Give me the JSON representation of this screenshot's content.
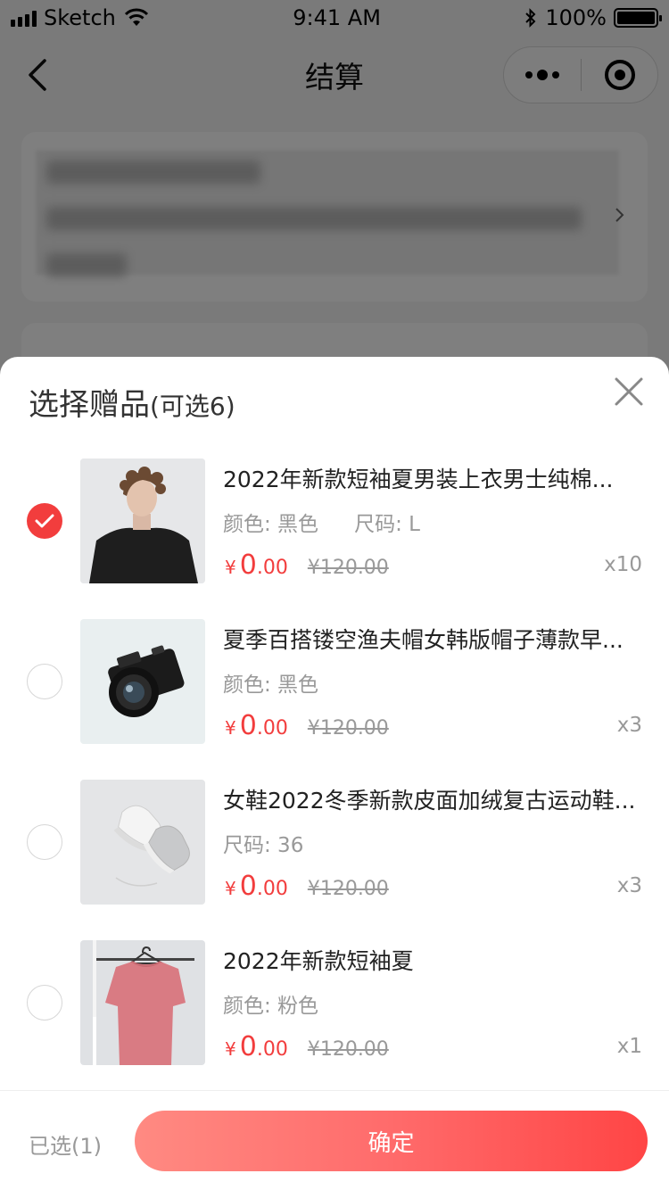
{
  "status_bar": {
    "carrier": "Sketch",
    "time": "9:41 AM",
    "battery": "100%"
  },
  "nav": {
    "title": "结算"
  },
  "popup": {
    "title": "选择赠品",
    "subtitle": "(可选6)",
    "currency_symbol": "¥",
    "items": [
      {
        "name": "2022年新款短袖夏男装上衣男士纯棉...",
        "spec_1": "颜色: 黑色",
        "spec_2": "尺码: L",
        "price_int": "0",
        "price_dec": ".00",
        "original_price": "¥120.00",
        "quantity": "x10",
        "checked": true
      },
      {
        "name": "夏季百搭镂空渔夫帽女韩版帽子薄款早...",
        "spec_1": "颜色: 黑色",
        "spec_2": "",
        "price_int": "0",
        "price_dec": ".00",
        "original_price": "¥120.00",
        "quantity": "x3",
        "checked": false
      },
      {
        "name": "女鞋2022冬季新款皮面加绒复古运动鞋...",
        "spec_1": "尺码: 36",
        "spec_2": "",
        "price_int": "0",
        "price_dec": ".00",
        "original_price": "¥120.00",
        "quantity": "x3",
        "checked": false
      },
      {
        "name": "2022年新款短袖夏",
        "spec_1": "颜色: 粉色",
        "spec_2": "",
        "price_int": "0",
        "price_dec": ".00",
        "original_price": "¥120.00",
        "quantity": "x1",
        "checked": false
      }
    ]
  },
  "footer": {
    "selected_label": "已选(1)",
    "confirm_label": "确定"
  },
  "colors": {
    "accent": "#f23d3d",
    "button_gradient_start": "#ff8a82",
    "button_gradient_end": "#ff4545",
    "overlay": "rgba(0,0,0,0.5)"
  }
}
